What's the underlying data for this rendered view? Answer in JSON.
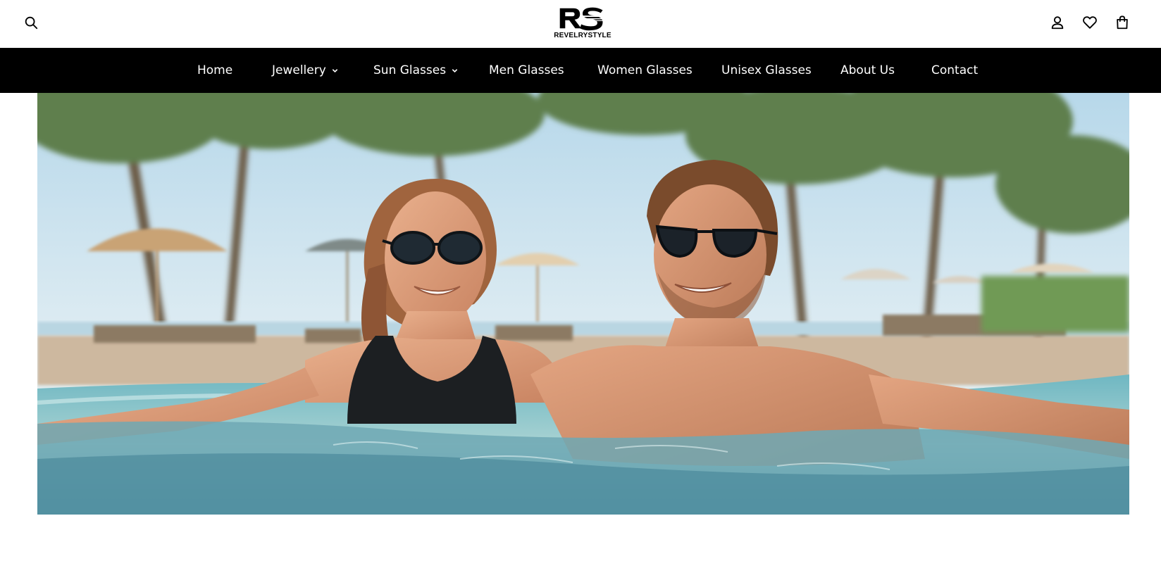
{
  "header": {
    "logo_text": "REVELRYSTYLE",
    "icons": {
      "search": "search-icon",
      "account": "user-icon",
      "wishlist": "heart-icon",
      "cart": "shopping-bag-icon"
    }
  },
  "nav": {
    "items": [
      {
        "label": "Home",
        "has_dropdown": false
      },
      {
        "label": "Jewellery",
        "has_dropdown": true
      },
      {
        "label": "Sun Glasses",
        "has_dropdown": true
      },
      {
        "label": "Men Glasses",
        "has_dropdown": false
      },
      {
        "label": "Women Glasses",
        "has_dropdown": false
      },
      {
        "label": "Unisex Glasses",
        "has_dropdown": false
      },
      {
        "label": "About Us",
        "has_dropdown": false
      },
      {
        "label": "Contact",
        "has_dropdown": false
      }
    ]
  },
  "colors": {
    "nav_background": "#000000",
    "nav_text": "#ffffff",
    "page_background": "#ffffff"
  }
}
